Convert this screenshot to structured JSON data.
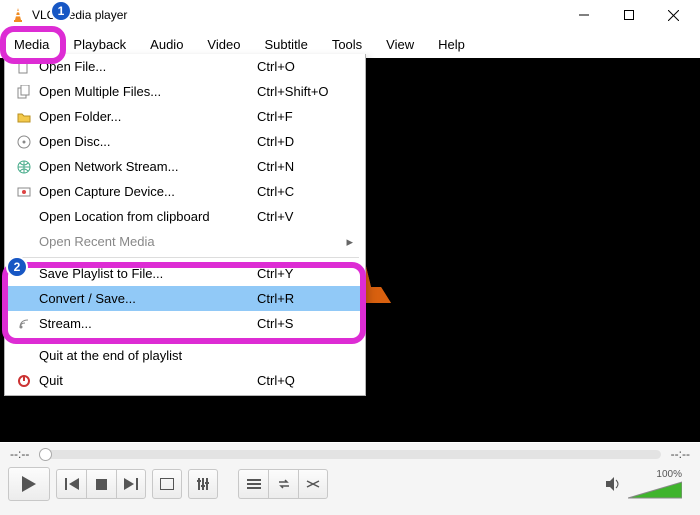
{
  "window": {
    "title": "VLC media player"
  },
  "menubar": [
    "Media",
    "Playback",
    "Audio",
    "Video",
    "Subtitle",
    "Tools",
    "View",
    "Help"
  ],
  "dropdown": {
    "items": [
      {
        "icon": "file",
        "label": "Open File...",
        "shortcut": "Ctrl+O"
      },
      {
        "icon": "files",
        "label": "Open Multiple Files...",
        "shortcut": "Ctrl+Shift+O"
      },
      {
        "icon": "folder",
        "label": "Open Folder...",
        "shortcut": "Ctrl+F"
      },
      {
        "icon": "disc",
        "label": "Open Disc...",
        "shortcut": "Ctrl+D"
      },
      {
        "icon": "net",
        "label": "Open Network Stream...",
        "shortcut": "Ctrl+N"
      },
      {
        "icon": "cap",
        "label": "Open Capture Device...",
        "shortcut": "Ctrl+C"
      },
      {
        "icon": "",
        "label": "Open Location from clipboard",
        "shortcut": "Ctrl+V"
      },
      {
        "icon": "",
        "label": "Open Recent Media",
        "shortcut": "",
        "sub": true,
        "disabled": true
      },
      {
        "sep": true
      },
      {
        "icon": "",
        "label": "Save Playlist to File...",
        "shortcut": "Ctrl+Y"
      },
      {
        "icon": "",
        "label": "Convert / Save...",
        "shortcut": "Ctrl+R",
        "highlight": true
      },
      {
        "icon": "stream",
        "label": "Stream...",
        "shortcut": "Ctrl+S"
      },
      {
        "sep": true
      },
      {
        "icon": "",
        "label": "Quit at the end of playlist",
        "shortcut": ""
      },
      {
        "icon": "quit",
        "label": "Quit",
        "shortcut": "Ctrl+Q"
      }
    ]
  },
  "seek": {
    "pos": "--:--",
    "dur": "--:--"
  },
  "volume": {
    "pct": "100%"
  },
  "annotations": {
    "b1": "1",
    "b2": "2"
  }
}
